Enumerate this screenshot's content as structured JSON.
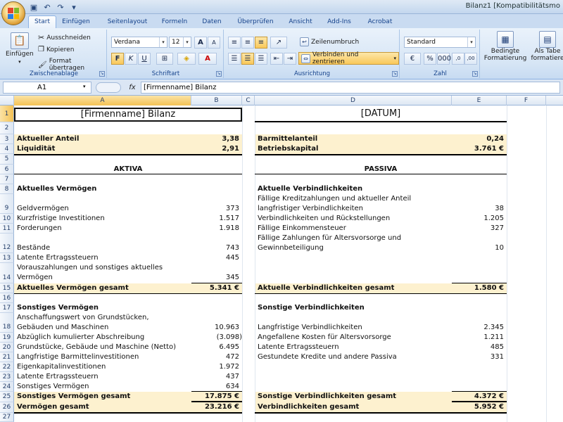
{
  "window": {
    "title": "Bilanz1 [Kompatibilitätsmo"
  },
  "tabs": [
    "Start",
    "Einfügen",
    "Seitenlayout",
    "Formeln",
    "Daten",
    "Überprüfen",
    "Ansicht",
    "Add-Ins",
    "Acrobat"
  ],
  "ribbon": {
    "clipboard": {
      "paste": "Einfügen",
      "cut": "Ausschneiden",
      "copy": "Kopieren",
      "format_painter": "Format übertragen",
      "label": "Zwischenablage"
    },
    "font": {
      "name": "Verdana",
      "size": "12",
      "label": "Schriftart",
      "bold": "F",
      "italic": "K",
      "underline": "U"
    },
    "alignment": {
      "wrap": "Zeilenumbruch",
      "merge": "Verbinden und zentrieren",
      "label": "Ausrichtung"
    },
    "number": {
      "format": "Standard",
      "label": "Zahl"
    },
    "styles": {
      "conditional": "Bedingte",
      "conditional2": "Formatierung",
      "astable": "Als Tabe",
      "astable2": "formatiere"
    }
  },
  "formula_bar": {
    "cell_ref": "A1",
    "fx": "fx",
    "content": "[Firmenname] Bilanz"
  },
  "columns": [
    "A",
    "B",
    "C",
    "D",
    "E",
    "F"
  ],
  "rows": [
    "1",
    "2",
    "3",
    "4",
    "5",
    "6",
    "7",
    "8",
    "9",
    "10",
    "11",
    "12",
    "13",
    "14",
    "15",
    "16",
    "17",
    "18",
    "19",
    "20",
    "21",
    "22",
    "23",
    "24",
    "25",
    "26",
    "27"
  ],
  "sheet": {
    "title_left": "[Firmenname] Bilanz",
    "title_right": "[DATUM]",
    "kpi": {
      "aktueller_anteil_label": "Aktueller Anteil",
      "aktueller_anteil_value": "3,38",
      "liquiditaet_label": "Liquidität",
      "liquiditaet_value": "2,91",
      "barmittelanteil_label": "Barmittelanteil",
      "barmittelanteil_value": "0,24",
      "betriebskapital_label": "Betriebskapital",
      "betriebskapital_value": "3.761 €"
    },
    "aktiva_header": "AKTIVA",
    "passiva_header": "PASSIVA",
    "current_assets_header": "Aktuelles Vermögen",
    "current_assets": [
      {
        "label": "Geldvermögen",
        "value": "373"
      },
      {
        "label": "Kurzfristige Investitionen",
        "value": "1.517"
      },
      {
        "label": "Forderungen",
        "value": "1.918"
      },
      {
        "label": "Bestände",
        "value": "743"
      },
      {
        "label": "Latente Ertragssteuern",
        "value": "445"
      },
      {
        "label": "Vorauszahlungen und sonstiges aktuelles",
        "label2": "Vermögen",
        "value": "345"
      }
    ],
    "current_assets_total_label": "Aktuelles Vermögen gesamt",
    "current_assets_total": "5.341 €",
    "current_liab_header": "Aktuelle Verbindlichkeiten",
    "current_liabilities": [
      {
        "label": "Fällige Kreditzahlungen und aktueller Anteil",
        "label2": "langfristiger Verbindlichkeiten",
        "value": "38"
      },
      {
        "label": "Verbindlichkeiten und Rückstellungen",
        "value": "1.205"
      },
      {
        "label": "Fällige Einkommensteuer",
        "value": "327"
      },
      {
        "label": "Fällige Zahlungen für Altersvorsorge und",
        "label2": "Gewinnbeteiligung",
        "value": "10"
      }
    ],
    "current_liab_total_label": "Aktuelle Verbindlichkeiten gesamt",
    "current_liab_total": "1.580 €",
    "other_assets_header": "Sonstiges Vermögen",
    "other_assets": [
      {
        "label": "Anschaffungswert von Grundstücken,",
        "label2": "Gebäuden und Maschinen",
        "value": "10.963"
      },
      {
        "label": "Abzüglich kumulierter Abschreibung",
        "value": "(3.098)"
      },
      {
        "label": "Grundstücke, Gebäude und Maschine (Netto)",
        "value": "6.495"
      },
      {
        "label": "Langfristige Barmittelinvestitionen",
        "value": "472"
      },
      {
        "label": "Eigenkapitalinvestitionen",
        "value": "1.972"
      },
      {
        "label": "Latente Ertragssteuern",
        "value": "437"
      },
      {
        "label": "Sonstiges Vermögen",
        "value": "634"
      }
    ],
    "other_assets_total_label": "Sonstiges Vermögen gesamt",
    "other_assets_total": "17.875 €",
    "other_liab_header": "Sonstige Verbindlichkeiten",
    "other_liabilities": [
      {
        "label": "Langfristige Verbindlichkeiten",
        "value": "2.345"
      },
      {
        "label": "Angefallene Kosten für Altersvorsorge",
        "value": "1.211"
      },
      {
        "label": "Latente Ertragssteuern",
        "value": "485"
      },
      {
        "label": "Gestundete Kredite und andere Passiva",
        "value": "331"
      }
    ],
    "other_liab_total_label": "Sonstige Verbindlichkeiten gesamt",
    "other_liab_total": "4.372 €",
    "assets_total_label": "Vermögen gesamt",
    "assets_total": "23.216 €",
    "liab_total_label": "Verbindlichkeiten gesamt",
    "liab_total": "5.952 €"
  }
}
